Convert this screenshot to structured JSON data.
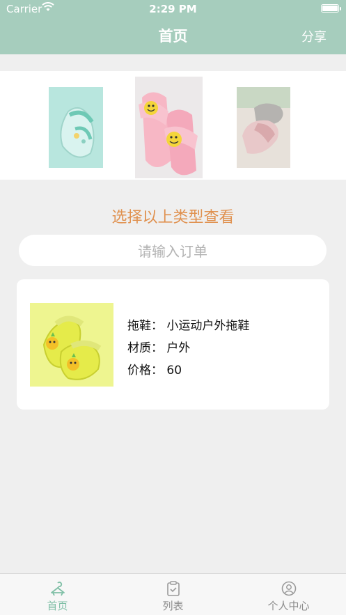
{
  "status_bar": {
    "carrier": "Carrier",
    "time": "2:29 PM"
  },
  "navbar": {
    "title": "首页",
    "share_label": "分享"
  },
  "banner": {
    "items": [
      {
        "name": "mint-kids-sandal"
      },
      {
        "name": "pink-smiley-slide"
      },
      {
        "name": "gray-pink-plush-slipper"
      }
    ]
  },
  "prompt_text": "选择以上类型查看",
  "search": {
    "placeholder": "请输入订单"
  },
  "product": {
    "slipper_line": "拖鞋：  小运动户外拖鞋",
    "material_line": "材质：  户外",
    "price_line": "价格：  60"
  },
  "tabbar": {
    "items": [
      {
        "label": "首页",
        "icon": "hanger-icon",
        "active": true
      },
      {
        "label": "列表",
        "icon": "list-clipboard-icon",
        "active": false
      },
      {
        "label": "个人中心",
        "icon": "user-circle-icon",
        "active": false
      }
    ]
  },
  "colors": {
    "header": "#a6cdbd",
    "accent_orange": "#e0914f",
    "active_tab": "#7fbfa6"
  }
}
